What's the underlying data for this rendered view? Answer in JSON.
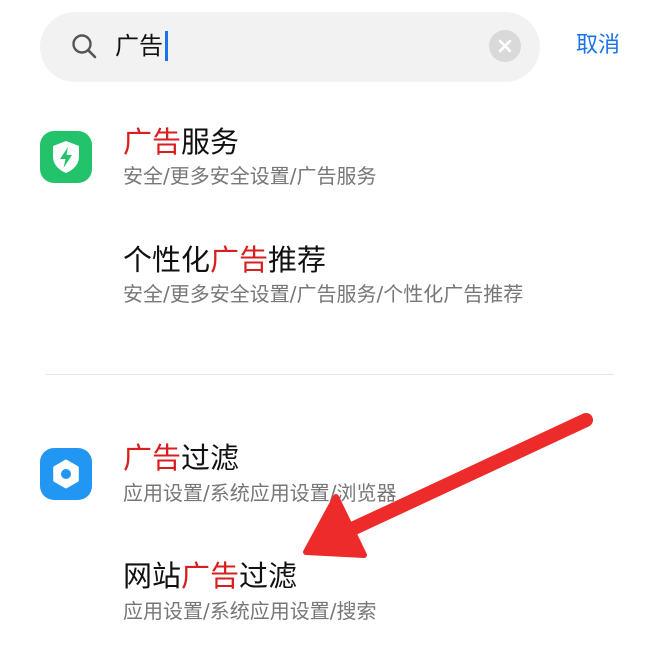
{
  "search": {
    "query": "广告"
  },
  "header": {
    "cancel_label": "取消"
  },
  "results": [
    {
      "title_before": "",
      "title_highlight": "广告",
      "title_after": "服务",
      "path": "安全/更多安全设置/广告服务",
      "icon": "shield-lightning-icon"
    },
    {
      "title_before": "个性化",
      "title_highlight": "广告",
      "title_after": "推荐",
      "path": "安全/更多安全设置/广告服务/个性化广告推荐"
    },
    {
      "title_before": "",
      "title_highlight": "广告",
      "title_after": "过滤",
      "path": "应用设置/系统应用设置/浏览器",
      "icon": "settings-gear-icon"
    },
    {
      "title_before": "网站",
      "title_highlight": "广告",
      "title_after": "过滤",
      "path": "应用设置/系统应用设置/搜索"
    }
  ],
  "colors": {
    "accent": "#1a73e8",
    "highlight": "#d81e1e",
    "security_icon_bg": "#22c36a",
    "settings_icon_bg": "#2196f3",
    "arrow": "#ee2b2b"
  }
}
